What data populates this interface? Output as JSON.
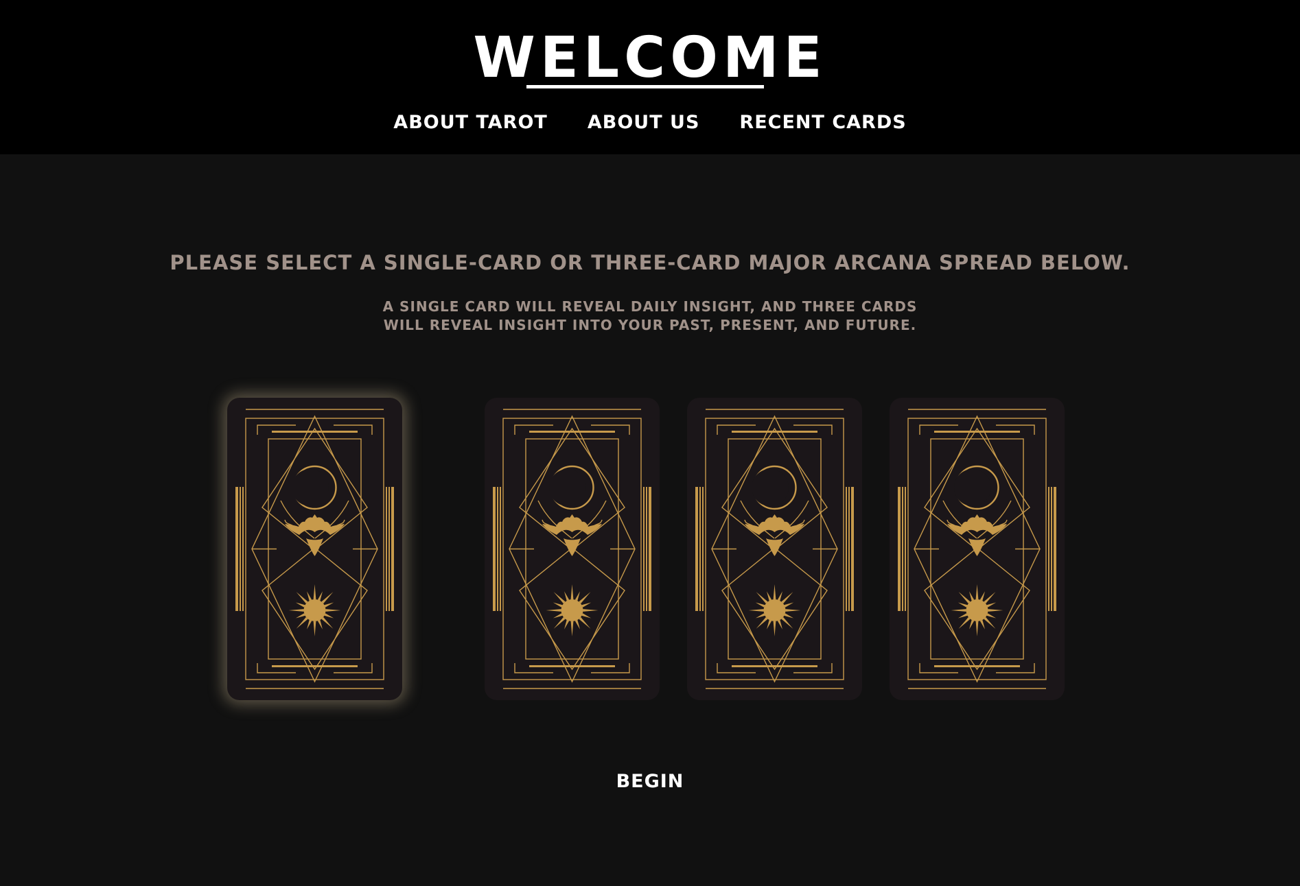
{
  "header": {
    "title": "WELCOME",
    "nav": [
      {
        "label": "ABOUT TAROT"
      },
      {
        "label": "ABOUT US"
      },
      {
        "label": "RECENT CARDS"
      }
    ]
  },
  "main": {
    "heading": "PLEASE SELECT A SINGLE-CARD OR THREE-CARD MAJOR ARCANA SPREAD BELOW.",
    "subtext": "A SINGLE CARD WILL REVEAL DAILY INSIGHT, AND THREE CARDS WILL REVEAL INSIGHT INTO YOUR PAST, PRESENT, AND FUTURE.",
    "cards": [
      {
        "icon": "moon-eagle-sun-icon",
        "selected": true
      },
      {
        "icon": "moon-eagle-sun-icon",
        "selected": false
      },
      {
        "icon": "moon-eagle-sun-icon",
        "selected": false
      },
      {
        "icon": "moon-eagle-sun-icon",
        "selected": false
      }
    ],
    "begin_label": "BEGIN"
  },
  "colors": {
    "page_bg": "#111111",
    "header_bg": "#000000",
    "text_muted": "#a1928a",
    "card_bg": "#1b1619",
    "gold": "#c79a4b"
  }
}
